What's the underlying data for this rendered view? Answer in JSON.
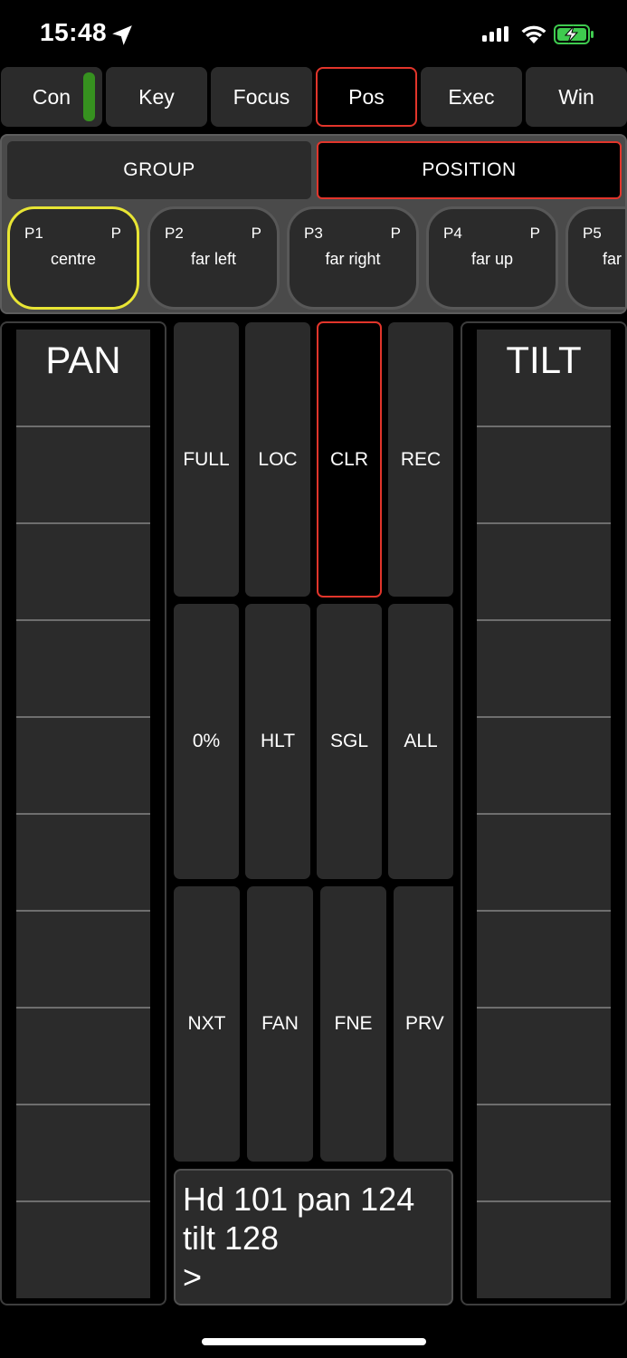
{
  "status_bar": {
    "time": "15:48",
    "icons": [
      "location-arrow-icon",
      "signal-icon",
      "wifi-icon",
      "battery-charging-icon"
    ],
    "battery_color": "#3fcb4f"
  },
  "tabs": [
    {
      "label": "Con",
      "active": false,
      "indicator_color": "#36911f"
    },
    {
      "label": "Key",
      "active": false
    },
    {
      "label": "Focus",
      "active": false
    },
    {
      "label": "Pos",
      "active": true
    },
    {
      "label": "Exec",
      "active": false
    },
    {
      "label": "Win",
      "active": false
    }
  ],
  "segments": {
    "group": "GROUP",
    "position": "POSITION",
    "selected": "POSITION"
  },
  "presets": [
    {
      "id": "P1",
      "flag": "P",
      "name": "centre",
      "selected": true
    },
    {
      "id": "P2",
      "flag": "P",
      "name": "far left",
      "selected": false
    },
    {
      "id": "P3",
      "flag": "P",
      "name": "far right",
      "selected": false
    },
    {
      "id": "P4",
      "flag": "P",
      "name": "far up",
      "selected": false
    },
    {
      "id": "P5",
      "flag": "",
      "name": "far",
      "selected": false
    }
  ],
  "faders": {
    "pan": "PAN",
    "tilt": "TILT"
  },
  "buttons": {
    "row1": [
      "FULL",
      "LOC",
      "CLR",
      "REC"
    ],
    "row2": [
      "0%",
      "HLT",
      "SGL",
      "ALL"
    ],
    "row3": [
      "NXT",
      "FAN",
      "FNE",
      "PRV"
    ],
    "active": "CLR"
  },
  "command_line": {
    "line1": "Hd 101 pan 124",
    "line2": "tilt 128",
    "prompt": ">"
  },
  "colors": {
    "accent_active": "#e2352b",
    "selected_preset": "#e8e534"
  }
}
